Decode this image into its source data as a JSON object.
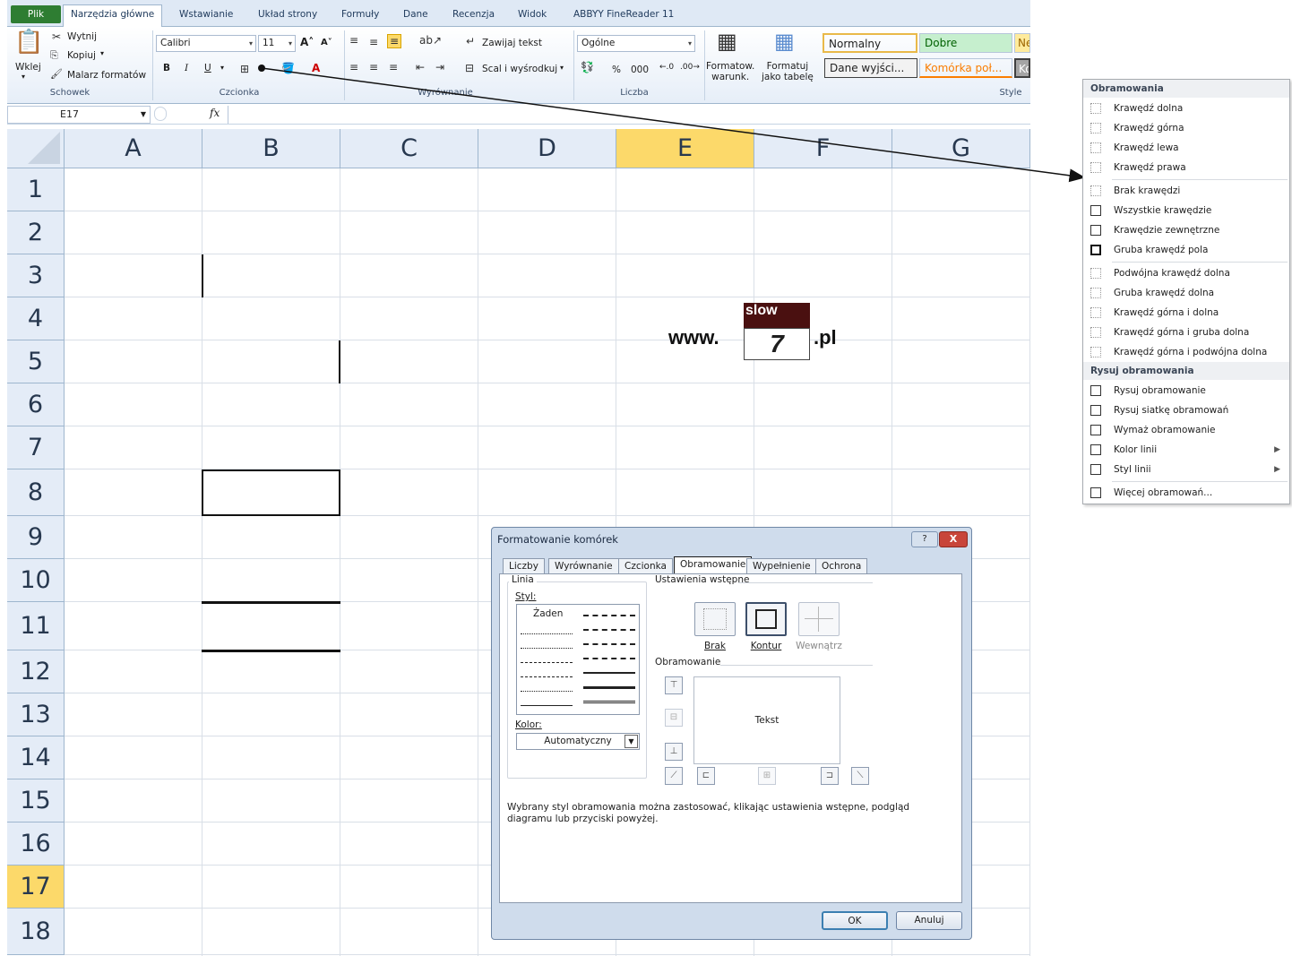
{
  "ribbon": {
    "tabs": [
      "Plik",
      "Narzędzia główne",
      "Wstawianie",
      "Układ strony",
      "Formuły",
      "Dane",
      "Recenzja",
      "Widok",
      "ABBYY FineReader 11"
    ],
    "clipboard": {
      "paste": "Wklej",
      "cut": "Wytnij",
      "copy": "Kopiuj",
      "painter": "Malarz formatów",
      "label": "Schowek"
    },
    "font": {
      "name": "Calibri",
      "size": "11",
      "bold": "B",
      "italic": "I",
      "underline": "U",
      "label": "Czcionka"
    },
    "alignment": {
      "wrap": "Zawijaj tekst",
      "merge": "Scal i wyśrodkuj",
      "label": "Wyrównanie"
    },
    "number": {
      "format": "Ogólne",
      "percent": "%",
      "thousands": "000",
      "label": "Liczba"
    },
    "styles": {
      "conditional": "Formatow.\nwarunk.",
      "table": "Formatuj\njako tabelę",
      "cells": [
        {
          "text": "Normalny",
          "bg": "#ffffff",
          "color": "#000000"
        },
        {
          "text": "Dobre",
          "bg": "#c6efce",
          "color": "#006100"
        },
        {
          "text": "Ne",
          "bg": "#ffeb9c",
          "color": "#9c6500"
        },
        {
          "text": "Dane wyjści...",
          "bg": "#f2f2f2",
          "color": "#3f3f3f"
        },
        {
          "text": "Komórka poł...",
          "bg": "#ffffff",
          "color": "#fa7d00"
        },
        {
          "text": "Ko",
          "bg": "#a5a5a5",
          "color": "#ffffff"
        }
      ],
      "label": "Style"
    }
  },
  "formula_bar": {
    "cell_ref": "E17",
    "fx": "fx"
  },
  "grid": {
    "columns": [
      "A",
      "B",
      "C",
      "D",
      "E",
      "F",
      "G"
    ],
    "rows": [
      "1",
      "2",
      "3",
      "4",
      "5",
      "6",
      "7",
      "8",
      "9",
      "10",
      "11",
      "12",
      "13",
      "14",
      "15",
      "16",
      "17",
      "18"
    ],
    "selected_column": "E",
    "selected_row": "17"
  },
  "logo": {
    "www": "www.",
    "slow": "slow",
    "seven": "7",
    "pl": ".pl"
  },
  "border_menu": {
    "header1": "Obramowania",
    "items1": [
      "Krawędź dolna",
      "Krawędź górna",
      "Krawędź lewa",
      "Krawędź prawa"
    ],
    "items2": [
      "Brak krawędzi",
      "Wszystkie krawędzie",
      "Krawędzie zewnętrzne",
      "Gruba krawędź pola"
    ],
    "items3": [
      "Podwójna krawędź dolna",
      "Gruba krawędź dolna",
      "Krawędź górna i dolna",
      "Krawędź górna i gruba dolna",
      "Krawędź górna i podwójna dolna"
    ],
    "header2": "Rysuj obramowania",
    "items4": [
      "Rysuj obramowanie",
      "Rysuj siatkę obramowań",
      "Wymaż obramowanie",
      "Kolor linii",
      "Styl linii"
    ],
    "more": "Więcej obramowań..."
  },
  "dialog": {
    "title": "Formatowanie komórek",
    "help": "?",
    "close": "X",
    "tabs": [
      "Liczby",
      "Wyrównanie",
      "Czcionka",
      "Obramowanie",
      "Wypełnienie",
      "Ochrona"
    ],
    "active_tab": "Obramowanie",
    "line_label": "Linia",
    "style_label": "Styl:",
    "none_style": "Żaden",
    "color_label": "Kolor:",
    "color_value": "Automatyczny",
    "presets_label": "Ustawienia wstępne",
    "presets": [
      "Brak",
      "Kontur",
      "Wewnątrz"
    ],
    "border_label": "Obramowanie",
    "preview_text": "Tekst",
    "hint": "Wybrany styl obramowania można zastosować, klikając ustawienia wstępne, podgląd diagramu lub przyciski powyżej.",
    "ok": "OK",
    "cancel": "Anuluj"
  }
}
